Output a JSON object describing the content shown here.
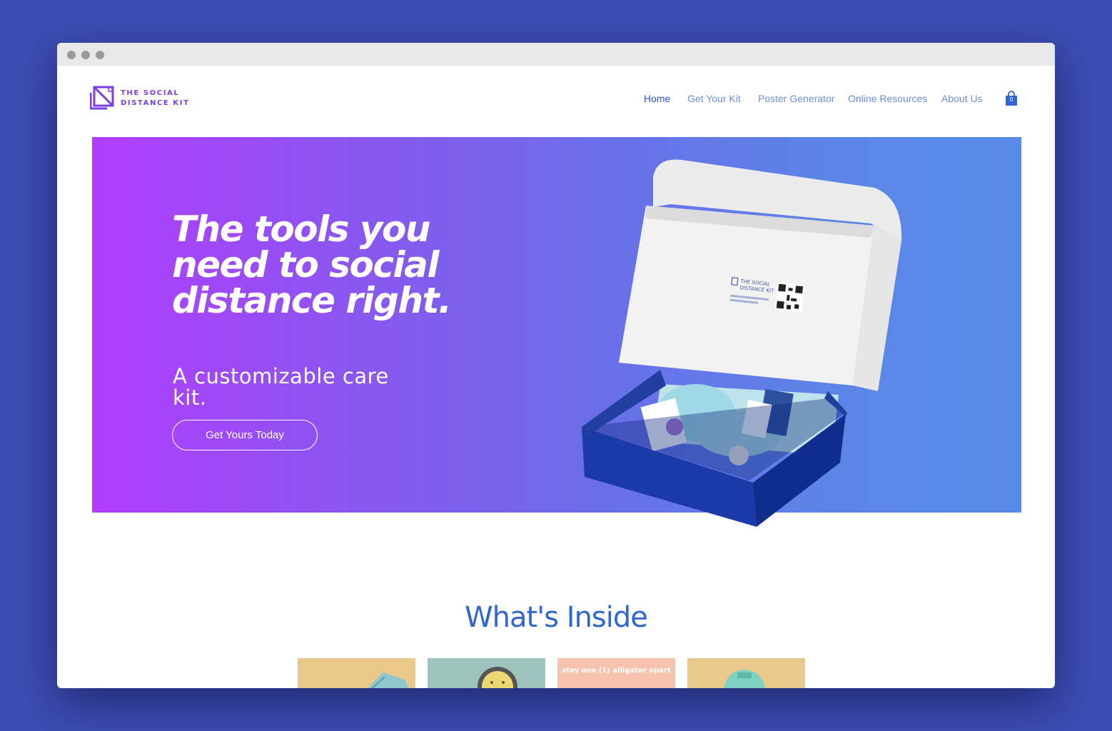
{
  "brand": {
    "name": "THE SOCIAL\nDISTANCE KIT",
    "accent": "#7b3fe4",
    "logo_icon": "kit-logo-icon"
  },
  "nav": {
    "items": [
      {
        "label": "Home",
        "active": true
      },
      {
        "label": "Get Your Kit",
        "active": false
      },
      {
        "label": "Poster Generator",
        "active": false
      },
      {
        "label": "Online Resources",
        "active": false
      },
      {
        "label": "About Us",
        "active": false
      }
    ],
    "cart": {
      "icon": "shopping-bag-icon",
      "count": "0"
    },
    "color": "#6b8fe0",
    "active_color": "#2f55d1"
  },
  "hero": {
    "headline": "The tools you need to social distance right.",
    "subheadline": "A customizable care kit.",
    "cta_label": "Get Yours Today",
    "gradient": [
      "#b23dff",
      "#5a8ae8"
    ],
    "image": "open-care-kit-box",
    "box_label": "THE SOCIAL\nDISTANCE KIT"
  },
  "whats_inside": {
    "title": "What's Inside",
    "title_color": "#2f66d0",
    "tiles": [
      {
        "image": "face-mask-tile",
        "bg": "#e9c88a",
        "caption": ""
      },
      {
        "image": "smiley-magnifier-tile",
        "bg": "#9ec4bd",
        "caption": ""
      },
      {
        "image": "alligator-poster-tile",
        "bg": "#f6c4ae",
        "caption": "stay one (1) alligator apart"
      },
      {
        "image": "tape-measure-tile",
        "bg": "#e8c98b",
        "caption": ""
      }
    ]
  }
}
